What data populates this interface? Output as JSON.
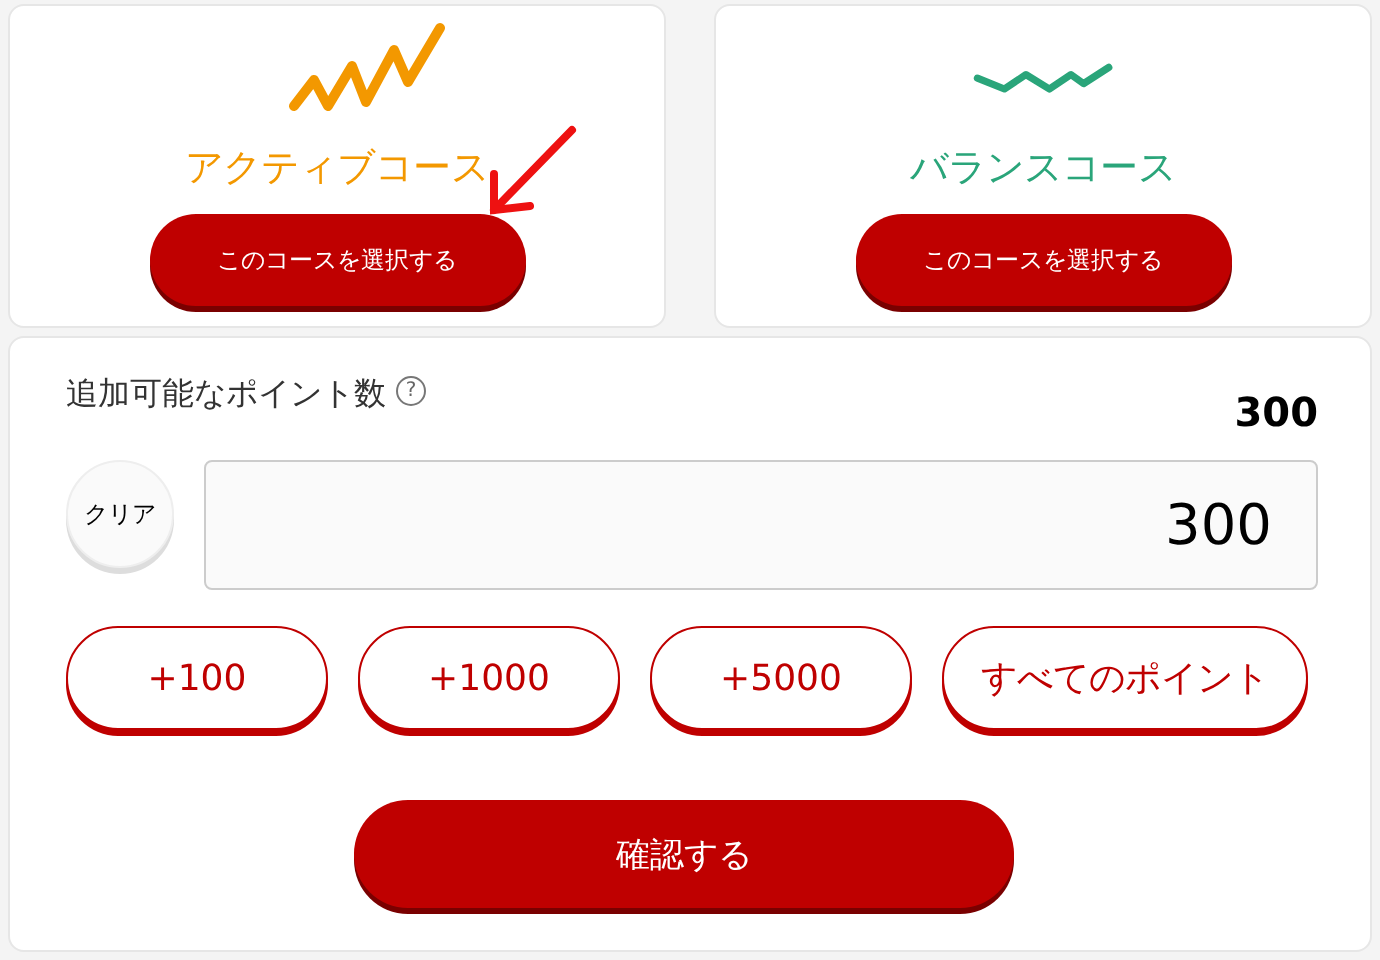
{
  "courses": [
    {
      "kind": "active",
      "name": "アクティブコース",
      "color": "#f39800",
      "button": "このコースを選択する"
    },
    {
      "kind": "balance",
      "name": "バランスコース",
      "color": "#2aa57a",
      "button": "このコースを選択する"
    }
  ],
  "points": {
    "label": "追加可能なポイント数",
    "help": "?",
    "total": "300",
    "clear": "クリア",
    "value": "300"
  },
  "quick_buttons": [
    "+100",
    "+1000",
    "+5000",
    "すべてのポイント"
  ],
  "confirm": "確認する"
}
